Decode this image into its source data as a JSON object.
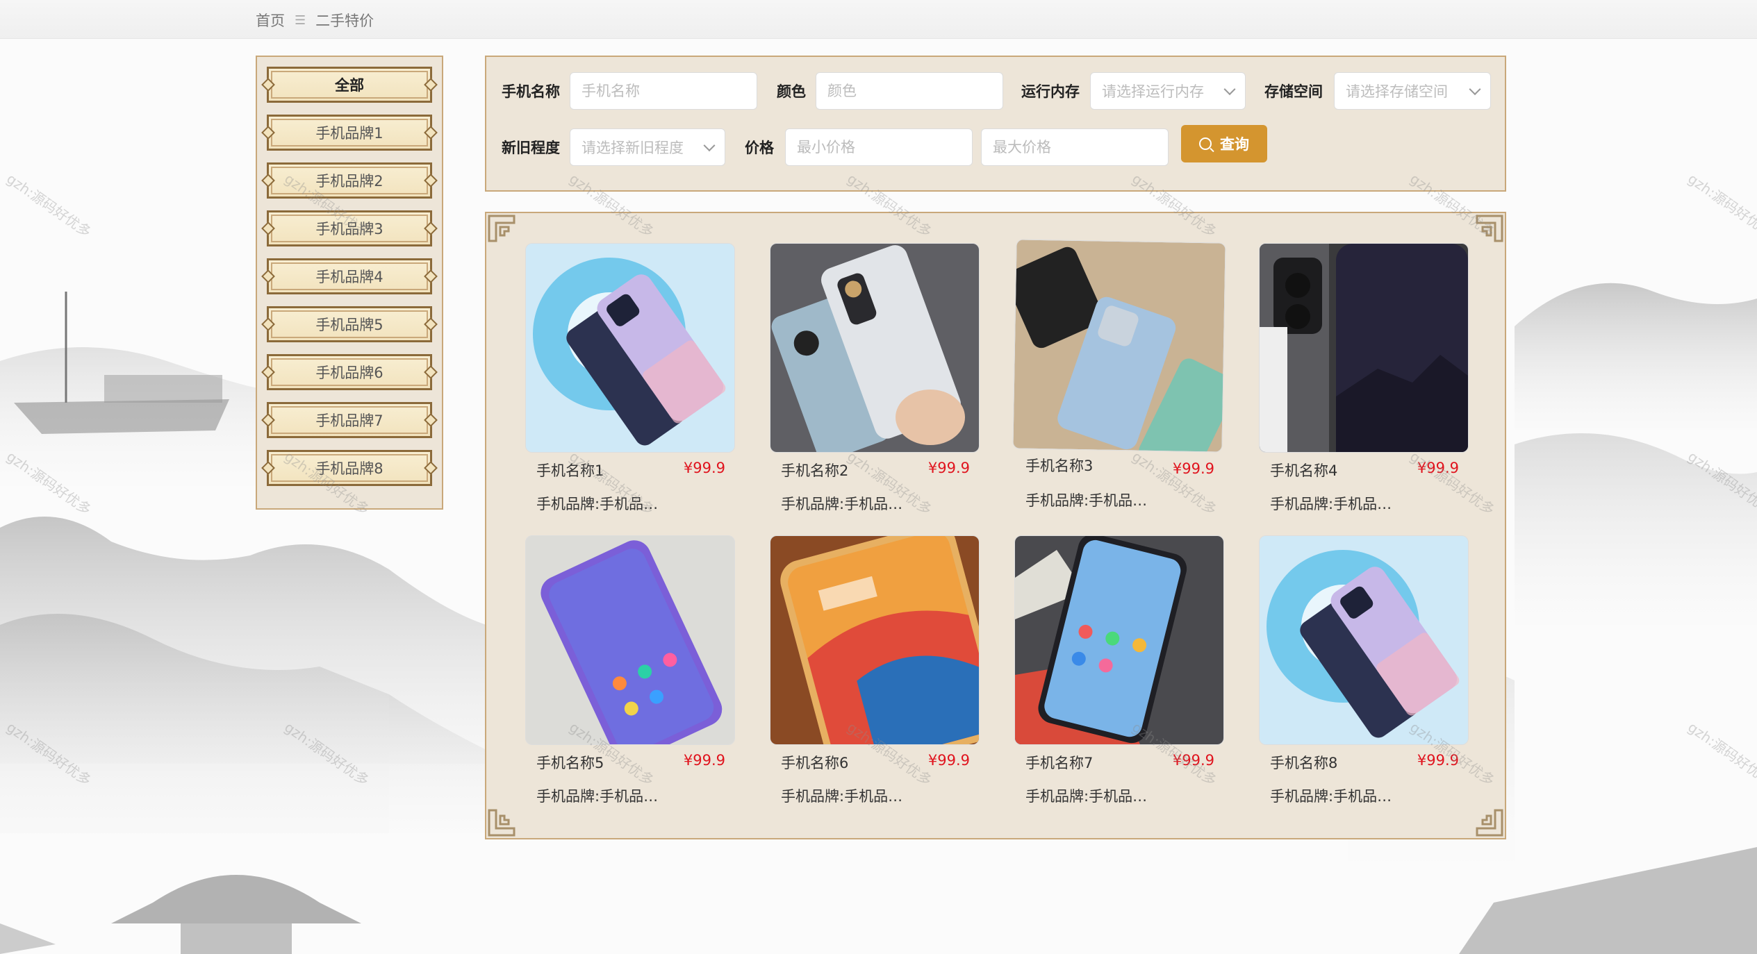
{
  "breadcrumb": {
    "home": "首页",
    "separator": "☰",
    "current": "二手特价"
  },
  "sidebar": {
    "items": [
      {
        "label": "全部",
        "active": true
      },
      {
        "label": "手机品牌1"
      },
      {
        "label": "手机品牌2"
      },
      {
        "label": "手机品牌3"
      },
      {
        "label": "手机品牌4"
      },
      {
        "label": "手机品牌5"
      },
      {
        "label": "手机品牌6"
      },
      {
        "label": "手机品牌7"
      },
      {
        "label": "手机品牌8"
      }
    ]
  },
  "filters": {
    "name_label": "手机名称",
    "name_placeholder": "手机名称",
    "color_label": "颜色",
    "color_placeholder": "颜色",
    "ram_label": "运行内存",
    "ram_placeholder": "请选择运行内存",
    "storage_label": "存储空间",
    "storage_placeholder": "请选择存储空间",
    "condition_label": "新旧程度",
    "condition_placeholder": "请选择新旧程度",
    "price_label": "价格",
    "min_price_placeholder": "最小价格",
    "max_price_placeholder": "最大价格",
    "query_label": "查询"
  },
  "products": [
    {
      "name": "手机名称1",
      "price": "¥99.9",
      "brand": "手机品牌:手机品…"
    },
    {
      "name": "手机名称2",
      "price": "¥99.9",
      "brand": "手机品牌:手机品…"
    },
    {
      "name": "手机名称3",
      "price": "¥99.9",
      "brand": "手机品牌:手机品…"
    },
    {
      "name": "手机名称4",
      "price": "¥99.9",
      "brand": "手机品牌:手机品…"
    },
    {
      "name": "手机名称5",
      "price": "¥99.9",
      "brand": "手机品牌:手机品…"
    },
    {
      "name": "手机名称6",
      "price": "¥99.9",
      "brand": "手机品牌:手机品…"
    },
    {
      "name": "手机名称7",
      "price": "¥99.9",
      "brand": "手机品牌:手机品…"
    },
    {
      "name": "手机名称8",
      "price": "¥99.9",
      "brand": "手机品牌:手机品…"
    }
  ],
  "watermark_text": "gzh:源码好优多",
  "colors": {
    "accent": "#d4952f",
    "panel": "#ede5d8",
    "border": "#c9a87a",
    "price": "#e0141e"
  }
}
